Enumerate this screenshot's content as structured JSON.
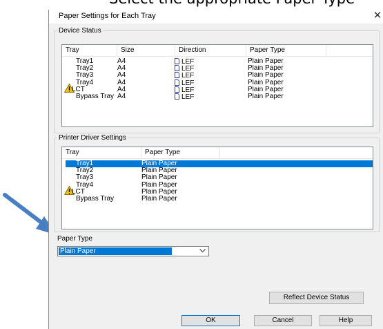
{
  "caption": "Select the appropriate Paper Type",
  "dialog": {
    "title": "Paper Settings for Each Tray",
    "device_status": {
      "legend": "Device Status",
      "columns": [
        "Tray",
        "Size",
        "Direction",
        "Paper Type"
      ],
      "rows": [
        {
          "tray": "Tray1",
          "size": "A4",
          "direction": "LEF",
          "paper_type": "Plain Paper",
          "warning": false
        },
        {
          "tray": "Tray2",
          "size": "A4",
          "direction": "LEF",
          "paper_type": "Plain Paper",
          "warning": false
        },
        {
          "tray": "Tray3",
          "size": "A4",
          "direction": "LEF",
          "paper_type": "Plain Paper",
          "warning": false
        },
        {
          "tray": "Tray4",
          "size": "A4",
          "direction": "LEF",
          "paper_type": "Plain Paper",
          "warning": false
        },
        {
          "tray": "LCT",
          "size": "A4",
          "direction": "LEF",
          "paper_type": "Plain Paper",
          "warning": true
        },
        {
          "tray": "Bypass Tray",
          "size": "A4",
          "direction": "LEF",
          "paper_type": "Plain Paper",
          "warning": false
        }
      ]
    },
    "driver_settings": {
      "legend": "Printer Driver Settings",
      "columns": [
        "Tray",
        "Paper Type"
      ],
      "selected_index": 0,
      "rows": [
        {
          "tray": "Tray1",
          "paper_type": "Plain Paper",
          "warning": false
        },
        {
          "tray": "Tray2",
          "paper_type": "Plain Paper",
          "warning": false
        },
        {
          "tray": "Tray3",
          "paper_type": "Plain Paper",
          "warning": false
        },
        {
          "tray": "Tray4",
          "paper_type": "Plain Paper",
          "warning": false
        },
        {
          "tray": "LCT",
          "paper_type": "Plain Paper",
          "warning": true
        },
        {
          "tray": "Bypass Tray",
          "paper_type": "Plain Paper",
          "warning": false
        }
      ]
    },
    "paper_type_label": "Paper Type",
    "paper_type_value": "Plain Paper",
    "reflect_button": "Reflect Device Status",
    "ok_button": "OK",
    "cancel_button": "Cancel",
    "help_button": "Help"
  },
  "icons": {
    "close": "close-icon",
    "warning": "warning-icon",
    "direction": "paper-direction-icon",
    "dropdown": "chevron-down-icon",
    "pointer": "arrow-pointer-icon"
  },
  "colors": {
    "selection": "#0078d7",
    "warning": "#f5c400",
    "arrow": "#4a7ec4",
    "dialog_bg": "#f0f0f0"
  }
}
